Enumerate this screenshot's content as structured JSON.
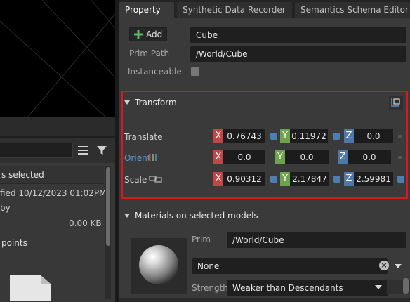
{
  "left": {
    "selection_label": "s selected",
    "modified_label": "fied 10/12/2023 01:02PM",
    "by_label": "by",
    "size_value": "0.00 KB",
    "points_label": "points"
  },
  "tabs": [
    {
      "label": "Property"
    },
    {
      "label": "Synthetic Data Recorder"
    },
    {
      "label": "Semantics Schema Editor"
    }
  ],
  "prim": {
    "add_label": "Add",
    "name_value": "Cube",
    "prim_path_label": "Prim Path",
    "prim_path_value": "/World/Cube",
    "instanceable_label": "Instanceable"
  },
  "transform": {
    "title": "Transform",
    "translate": {
      "label": "Translate",
      "x": "0.76743",
      "y": "0.11972",
      "z": "0.0"
    },
    "orient": {
      "label": "Orient",
      "x": "0.0",
      "y": "0.0",
      "z": "0.0"
    },
    "scale": {
      "label": "Scale",
      "x": "0.90312",
      "y": "2.17847",
      "z": "2.59981"
    }
  },
  "axes": {
    "x": "X",
    "y": "Y",
    "z": "Z"
  },
  "materials": {
    "title": "Materials on selected models",
    "prim_label": "Prim",
    "prim_value": "/World/Cube",
    "material_value": "None",
    "strength_label": "Strength",
    "strength_value": "Weaker than Descendants"
  },
  "colors": {
    "highlight_border": "#d41a1a",
    "axis_x": "#c24646",
    "axis_y": "#6fa24c",
    "axis_z": "#4d78a8",
    "add_icon": "#5cb85c"
  },
  "icons": [
    "list-icon",
    "filter-icon",
    "plus-icon",
    "orient-bars-icon",
    "link-icon",
    "transform-settings-icon",
    "clear-icon",
    "chevron-down-icon",
    "file-icon"
  ]
}
